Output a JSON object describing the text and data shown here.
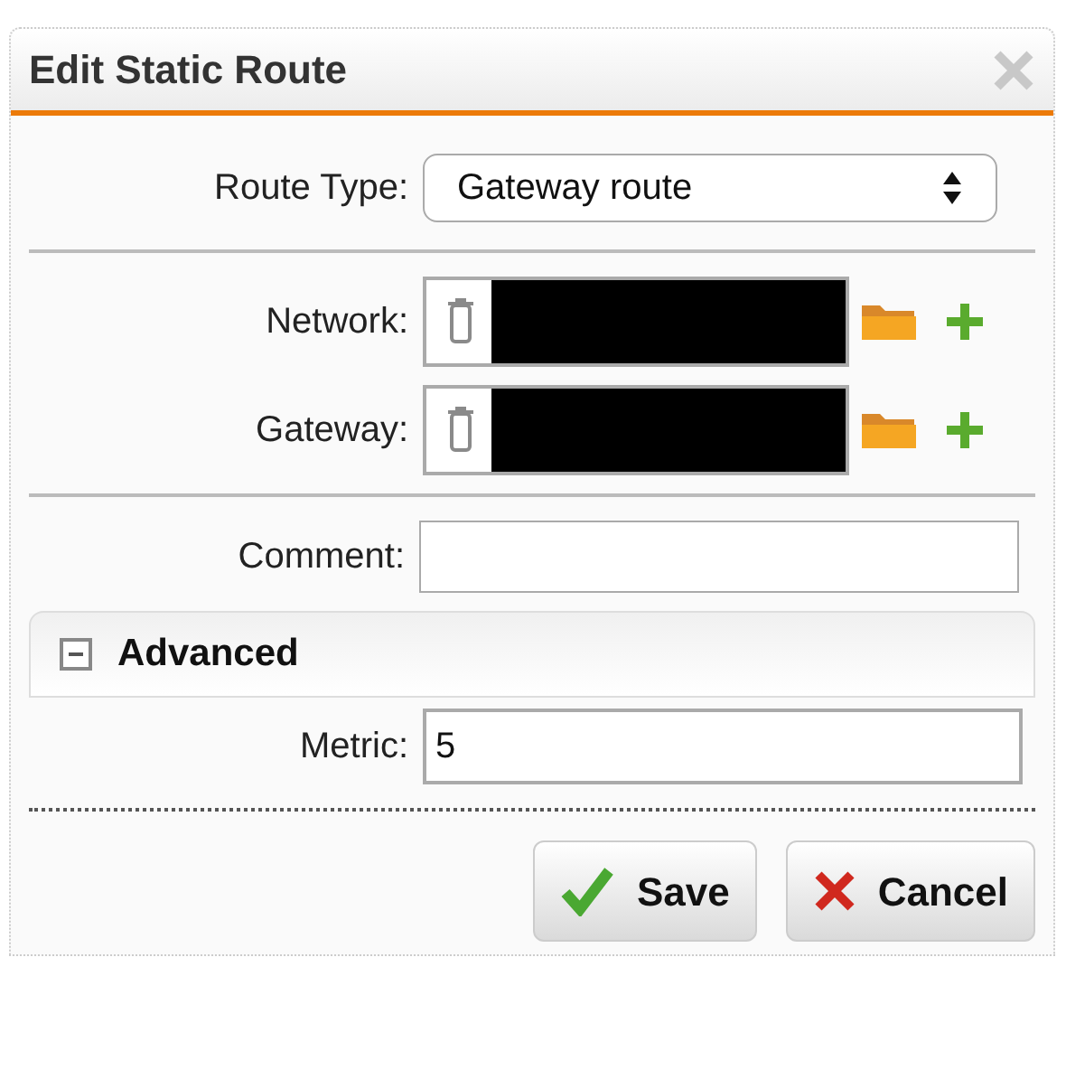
{
  "dialog": {
    "title": "Edit Static Route"
  },
  "route_type": {
    "label": "Route Type:",
    "value": "Gateway route"
  },
  "objects": [
    {
      "label": "Network:",
      "redacted": true
    },
    {
      "label": "Gateway:",
      "redacted": true
    }
  ],
  "comment": {
    "label": "Comment:"
  },
  "advanced": {
    "title": "Advanced",
    "expanded": true,
    "metric": {
      "label": "Metric:",
      "value": "5"
    }
  },
  "buttons": [
    {
      "kind": "save",
      "label": "Save"
    },
    {
      "kind": "cancel",
      "label": "Cancel"
    }
  ]
}
